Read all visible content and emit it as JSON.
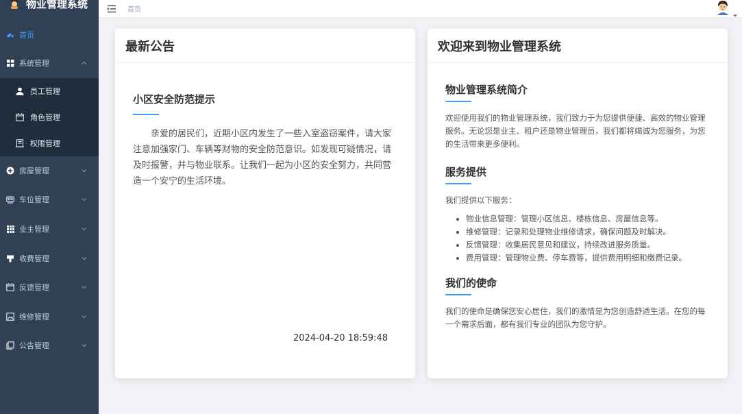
{
  "brand": {
    "title": "物业管理系统"
  },
  "sidebar": {
    "items": [
      {
        "label": "首页",
        "icon": "dashboard-icon"
      },
      {
        "label": "系统管理",
        "icon": "grid-icon"
      },
      {
        "label": "员工管理",
        "icon": "user-icon"
      },
      {
        "label": "角色管理",
        "icon": "calendar-icon"
      },
      {
        "label": "权限管理",
        "icon": "building-icon"
      },
      {
        "label": "房屋管理",
        "icon": "plus-circle-icon"
      },
      {
        "label": "车位管理",
        "icon": "car-icon"
      },
      {
        "label": "业主管理",
        "icon": "apps-icon"
      },
      {
        "label": "收费管理",
        "icon": "ticket-icon"
      },
      {
        "label": "反馈管理",
        "icon": "calendar-icon"
      },
      {
        "label": "维修管理",
        "icon": "picture-icon"
      },
      {
        "label": "公告管理",
        "icon": "copy-icon"
      }
    ]
  },
  "topbar": {
    "breadcrumb": "首页"
  },
  "announcement": {
    "header": "最新公告",
    "title": "小区安全防范提示",
    "body": "亲爱的居民们，近期小区内发生了一些入室盗窃案件，请大家注意加强家门、车辆等财物的安全防范意识。如发现可疑情况，请及时报警，并与物业联系。让我们一起为小区的安全努力，共同营造一个安宁的生活环境。",
    "time": "2024-04-20 18:59:48"
  },
  "welcome": {
    "header": "欢迎来到物业管理系统",
    "intro_title": "物业管理系统简介",
    "intro_text": "欢迎使用我们的物业管理系统，我们致力于为您提供便捷、高效的物业管理服务。无论您是业主、租户还是物业管理员，我们都将竭诚为您服务，为您的生活带来更多便利。",
    "services_title": "服务提供",
    "services_lead": "我们提供以下服务：",
    "services": [
      "物业信息管理：管理小区信息、楼栋信息、房屋信息等。",
      "维修管理：记录和处理物业维修请求，确保问题及时解决。",
      "反馈管理：收集居民意见和建议，持续改进服务质量。",
      "费用管理：管理物业费、停车费等，提供费用明细和缴费记录。"
    ],
    "mission_title": "我们的使命",
    "mission_text": "我们的使命是确保您安心居住，我们的激情是为您创造舒适生活。在您的每一个需求后面，都有我们专业的团队为您守护。"
  },
  "colors": {
    "sidebar_bg": "#304156",
    "submenu_bg": "#1f2d3d",
    "accent": "#409eff"
  }
}
